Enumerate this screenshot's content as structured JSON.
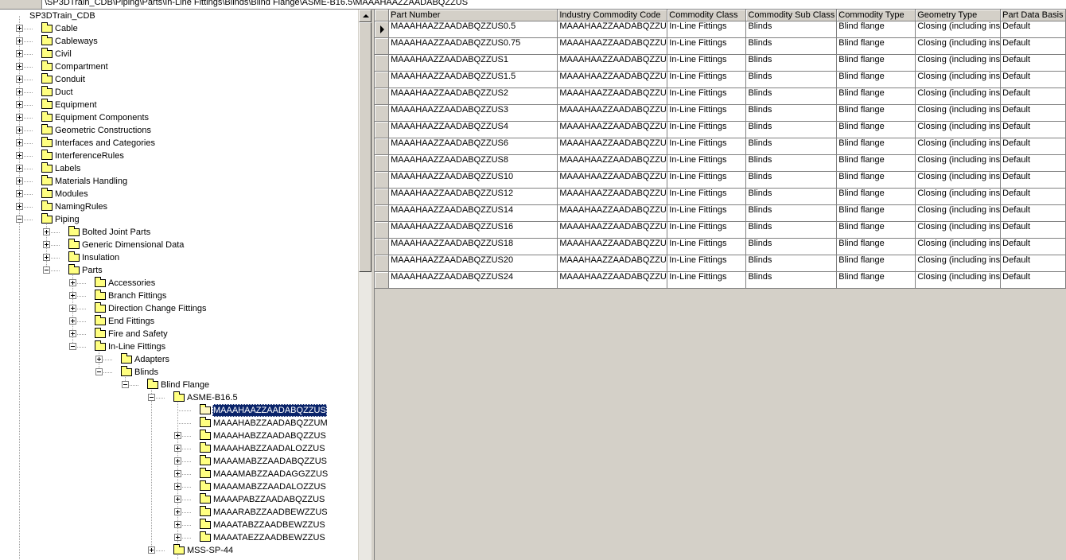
{
  "path_bar": {
    "path": "\\SP3DTrain_CDB\\Piping\\Parts\\In-Line Fittings\\Blinds\\Blind Flange\\ASME-B16.5\\MAAAHAAZZAADABQZZUS"
  },
  "tree": {
    "root_label": "SP3DTrain_CDB",
    "nodes": [
      {
        "label": "Cable",
        "level": 1,
        "expander": "plus"
      },
      {
        "label": "Cableways",
        "level": 1,
        "expander": "plus"
      },
      {
        "label": "Civil",
        "level": 1,
        "expander": "plus"
      },
      {
        "label": "Compartment",
        "level": 1,
        "expander": "plus"
      },
      {
        "label": "Conduit",
        "level": 1,
        "expander": "plus"
      },
      {
        "label": "Duct",
        "level": 1,
        "expander": "plus"
      },
      {
        "label": "Equipment",
        "level": 1,
        "expander": "plus"
      },
      {
        "label": "Equipment Components",
        "level": 1,
        "expander": "plus"
      },
      {
        "label": "Geometric Constructions",
        "level": 1,
        "expander": "plus"
      },
      {
        "label": "Interfaces and Categories",
        "level": 1,
        "expander": "plus"
      },
      {
        "label": "InterferenceRules",
        "level": 1,
        "expander": "plus"
      },
      {
        "label": "Labels",
        "level": 1,
        "expander": "plus"
      },
      {
        "label": "Materials Handling",
        "level": 1,
        "expander": "plus"
      },
      {
        "label": "Modules",
        "level": 1,
        "expander": "plus"
      },
      {
        "label": "NamingRules",
        "level": 1,
        "expander": "plus"
      },
      {
        "label": "Piping",
        "level": 1,
        "expander": "minus"
      },
      {
        "label": "Bolted Joint Parts",
        "level": 2,
        "expander": "plus"
      },
      {
        "label": "Generic Dimensional Data",
        "level": 2,
        "expander": "plus"
      },
      {
        "label": "Insulation",
        "level": 2,
        "expander": "plus"
      },
      {
        "label": "Parts",
        "level": 2,
        "expander": "minus"
      },
      {
        "label": "Accessories",
        "level": 3,
        "expander": "plus"
      },
      {
        "label": "Branch Fittings",
        "level": 3,
        "expander": "plus"
      },
      {
        "label": "Direction Change Fittings",
        "level": 3,
        "expander": "plus"
      },
      {
        "label": "End Fittings",
        "level": 3,
        "expander": "plus"
      },
      {
        "label": "Fire and Safety",
        "level": 3,
        "expander": "plus"
      },
      {
        "label": "In-Line Fittings",
        "level": 3,
        "expander": "minus"
      },
      {
        "label": "Adapters",
        "level": 4,
        "expander": "plus"
      },
      {
        "label": "Blinds",
        "level": 4,
        "expander": "minus"
      },
      {
        "label": "Blind Flange",
        "level": 5,
        "expander": "minus"
      },
      {
        "label": "ASME-B16.5",
        "level": 6,
        "expander": "minus"
      },
      {
        "label": "MAAAHAAZZAADABQZZUS",
        "level": 7,
        "expander": "none",
        "selected": true
      },
      {
        "label": "MAAAHABZZAADABQZZUM",
        "level": 7,
        "expander": "none"
      },
      {
        "label": "MAAAHABZZAADABQZZUS",
        "level": 7,
        "expander": "plus"
      },
      {
        "label": "MAAAHABZZAADALOZZUS",
        "level": 7,
        "expander": "plus"
      },
      {
        "label": "MAAAMABZZAADABQZZUS",
        "level": 7,
        "expander": "plus"
      },
      {
        "label": "MAAAMABZZAADAGGZZUS",
        "level": 7,
        "expander": "plus"
      },
      {
        "label": "MAAAMABZZAADALOZZUS",
        "level": 7,
        "expander": "plus"
      },
      {
        "label": "MAAAPABZZAADABQZZUS",
        "level": 7,
        "expander": "plus"
      },
      {
        "label": "MAAARABZZAADBEWZZUS",
        "level": 7,
        "expander": "plus"
      },
      {
        "label": "MAAATABZZAADBEWZZUS",
        "level": 7,
        "expander": "plus"
      },
      {
        "label": "MAAATAEZZAADBEWZZUS",
        "level": 7,
        "expander": "plus"
      },
      {
        "label": "MSS-SP-44",
        "level": 6,
        "expander": "plus"
      }
    ]
  },
  "grid": {
    "columns": [
      "Part Number",
      "Industry Commodity Code",
      "Commodity Class",
      "Commodity Sub Class",
      "Commodity Type",
      "Geometry Type",
      "Part Data Basis"
    ],
    "current_row": 0,
    "rows": [
      [
        "MAAAHAAZZAADABQZZUS0.5",
        "MAAAHAAZZAADABQZZU",
        "In-Line Fittings",
        "Blinds",
        "Blind flange",
        "Closing (including ins",
        "Default"
      ],
      [
        "MAAAHAAZZAADABQZZUS0.75",
        "MAAAHAAZZAADABQZZU",
        "In-Line Fittings",
        "Blinds",
        "Blind flange",
        "Closing (including ins",
        "Default"
      ],
      [
        "MAAAHAAZZAADABQZZUS1",
        "MAAAHAAZZAADABQZZU",
        "In-Line Fittings",
        "Blinds",
        "Blind flange",
        "Closing (including ins",
        "Default"
      ],
      [
        "MAAAHAAZZAADABQZZUS1.5",
        "MAAAHAAZZAADABQZZU",
        "In-Line Fittings",
        "Blinds",
        "Blind flange",
        "Closing (including ins",
        "Default"
      ],
      [
        "MAAAHAAZZAADABQZZUS2",
        "MAAAHAAZZAADABQZZU",
        "In-Line Fittings",
        "Blinds",
        "Blind flange",
        "Closing (including ins",
        "Default"
      ],
      [
        "MAAAHAAZZAADABQZZUS3",
        "MAAAHAAZZAADABQZZU",
        "In-Line Fittings",
        "Blinds",
        "Blind flange",
        "Closing (including ins",
        "Default"
      ],
      [
        "MAAAHAAZZAADABQZZUS4",
        "MAAAHAAZZAADABQZZU",
        "In-Line Fittings",
        "Blinds",
        "Blind flange",
        "Closing (including ins",
        "Default"
      ],
      [
        "MAAAHAAZZAADABQZZUS6",
        "MAAAHAAZZAADABQZZU",
        "In-Line Fittings",
        "Blinds",
        "Blind flange",
        "Closing (including ins",
        "Default"
      ],
      [
        "MAAAHAAZZAADABQZZUS8",
        "MAAAHAAZZAADABQZZU",
        "In-Line Fittings",
        "Blinds",
        "Blind flange",
        "Closing (including ins",
        "Default"
      ],
      [
        "MAAAHAAZZAADABQZZUS10",
        "MAAAHAAZZAADABQZZU",
        "In-Line Fittings",
        "Blinds",
        "Blind flange",
        "Closing (including ins",
        "Default"
      ],
      [
        "MAAAHAAZZAADABQZZUS12",
        "MAAAHAAZZAADABQZZU",
        "In-Line Fittings",
        "Blinds",
        "Blind flange",
        "Closing (including ins",
        "Default"
      ],
      [
        "MAAAHAAZZAADABQZZUS14",
        "MAAAHAAZZAADABQZZU",
        "In-Line Fittings",
        "Blinds",
        "Blind flange",
        "Closing (including ins",
        "Default"
      ],
      [
        "MAAAHAAZZAADABQZZUS16",
        "MAAAHAAZZAADABQZZU",
        "In-Line Fittings",
        "Blinds",
        "Blind flange",
        "Closing (including ins",
        "Default"
      ],
      [
        "MAAAHAAZZAADABQZZUS18",
        "MAAAHAAZZAADABQZZU",
        "In-Line Fittings",
        "Blinds",
        "Blind flange",
        "Closing (including ins",
        "Default"
      ],
      [
        "MAAAHAAZZAADABQZZUS20",
        "MAAAHAAZZAADABQZZU",
        "In-Line Fittings",
        "Blinds",
        "Blind flange",
        "Closing (including ins",
        "Default"
      ],
      [
        "MAAAHAAZZAADABQZZUS24",
        "MAAAHAAZZAADABQZZU",
        "In-Line Fittings",
        "Blinds",
        "Blind flange",
        "Closing (including ins",
        "Default"
      ]
    ]
  }
}
